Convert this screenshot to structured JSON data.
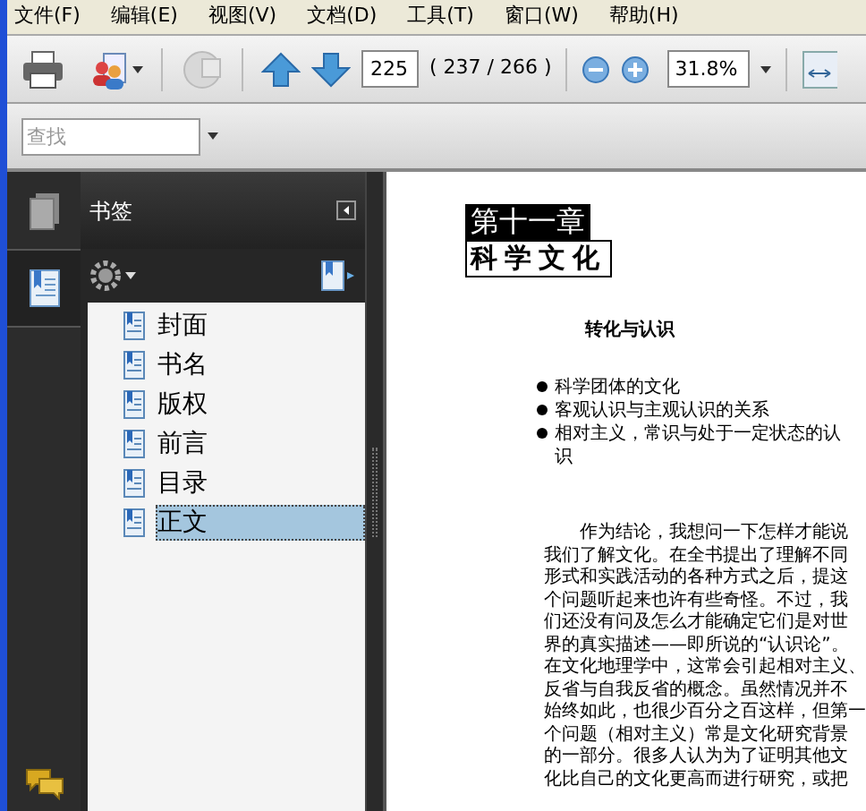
{
  "menu": [
    {
      "label": "文件(F)"
    },
    {
      "label": "编辑(E)"
    },
    {
      "label": "视图(V)"
    },
    {
      "label": "文档(D)"
    },
    {
      "label": "工具(T)"
    },
    {
      "label": "窗口(W)"
    },
    {
      "label": "帮助(H)"
    }
  ],
  "toolbar": {
    "page_field": "225",
    "page_count": "( 237 / 266 )",
    "zoom_field": "31.8%"
  },
  "search": {
    "placeholder": "查找"
  },
  "panel": {
    "title": "书签"
  },
  "bookmarks": [
    {
      "label": "封面",
      "selected": false
    },
    {
      "label": "书名",
      "selected": false
    },
    {
      "label": "版权",
      "selected": false
    },
    {
      "label": "前言",
      "selected": false
    },
    {
      "label": "目录",
      "selected": false
    },
    {
      "label": "正文",
      "selected": true
    }
  ],
  "document": {
    "chapter_number": "第十一章",
    "chapter_title": "科学文化",
    "section_title": "转化与认识",
    "bullets": [
      "科学团体的文化",
      "客观认识与主观认识的关系",
      "相对主义，常识与处于一定状态的认识"
    ],
    "lines": [
      "作为结论，我想问一下怎样才能说",
      "我们了解文化。在全书提出了理解不同",
      "形式和实践活动的各种方式之后，提这",
      "个问题听起来也许有些奇怪。不过，我",
      "们还没有问及怎么才能确定它们是对世",
      "界的真实描述——即所说的“认识论”。",
      "在文化地理学中，这常会引起相对主义、",
      "反省与自我反省的概念。虽然情况并不",
      "始终如此，也很少百分之百这样，但第一",
      "个问题（相对主义）常是文化研究背景",
      "的一部分。很多人认为为了证明其他文",
      "化比自己的文化更高而进行研究，或把"
    ]
  }
}
